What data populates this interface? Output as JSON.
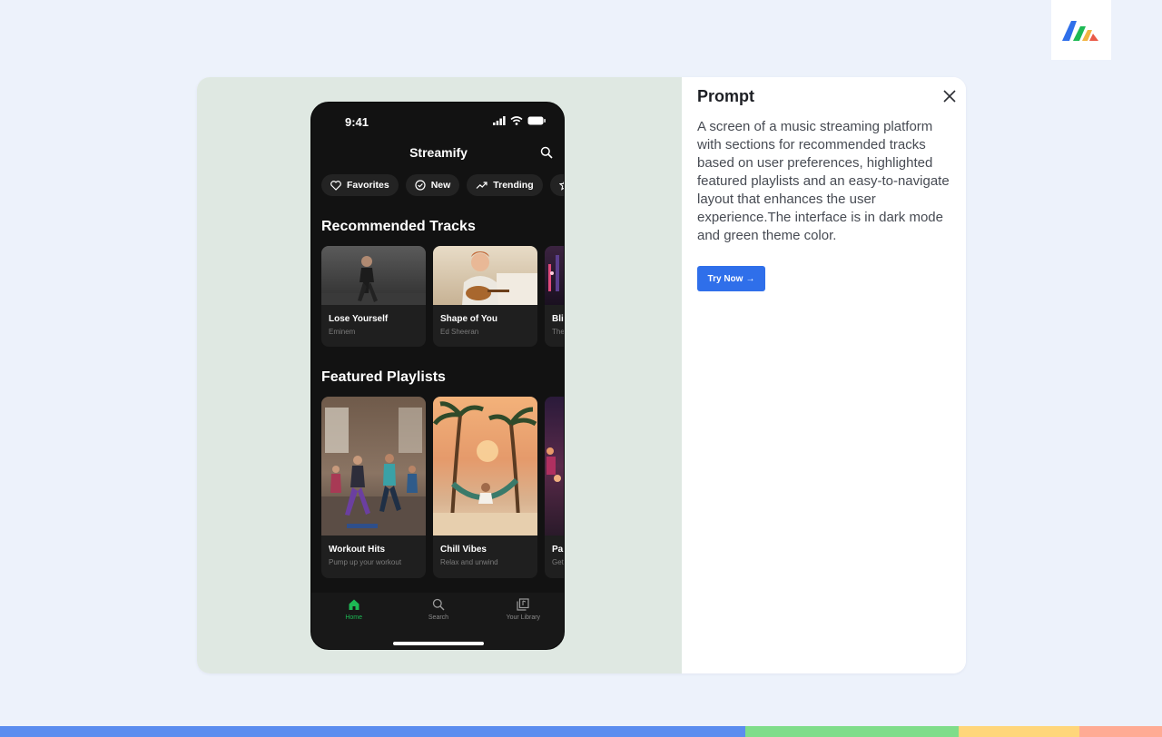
{
  "phone": {
    "status_time": "9:41",
    "app_title": "Streamify",
    "chips": [
      {
        "label": "Favorites",
        "icon": "heart-icon"
      },
      {
        "label": "New",
        "icon": "check-circle-icon"
      },
      {
        "label": "Trending",
        "icon": "trending-up-icon"
      },
      {
        "label": "",
        "icon": "star-icon"
      }
    ],
    "recommended": {
      "title": "Recommended Tracks",
      "items": [
        {
          "name": "Lose Yourself",
          "artist": "Eminem"
        },
        {
          "name": "Shape of You",
          "artist": "Ed Sheeran"
        },
        {
          "name": "Bli",
          "artist": "The"
        }
      ]
    },
    "playlists": {
      "title": "Featured Playlists",
      "items": [
        {
          "name": "Workout Hits",
          "desc": "Pump up your workout"
        },
        {
          "name": "Chill Vibes",
          "desc": "Relax and unwind"
        },
        {
          "name": "Pa",
          "desc": "Get"
        }
      ]
    },
    "tabs": [
      {
        "label": "Home",
        "icon": "home-icon",
        "active": true
      },
      {
        "label": "Search",
        "icon": "search-icon",
        "active": false
      },
      {
        "label": "Your Library",
        "icon": "library-icon",
        "active": false
      }
    ],
    "accent_color": "#1db954"
  },
  "panel": {
    "title": "Prompt",
    "description": "A screen of a music streaming platform with sections for recommended tracks based on user preferences, highlighted featured playlists and an easy-to-navigate layout that enhances the user experience.The interface is in dark mode and green theme color.",
    "try_button": "Try Now",
    "try_arrow": "→"
  },
  "colors": {
    "page_bg": "#edf2fb",
    "preview_bg": "#dfe8e2",
    "button_blue": "#2f6fea",
    "strip": [
      "#5b8def",
      "#7fdd8a",
      "#ffd67a",
      "#ffab94"
    ]
  }
}
